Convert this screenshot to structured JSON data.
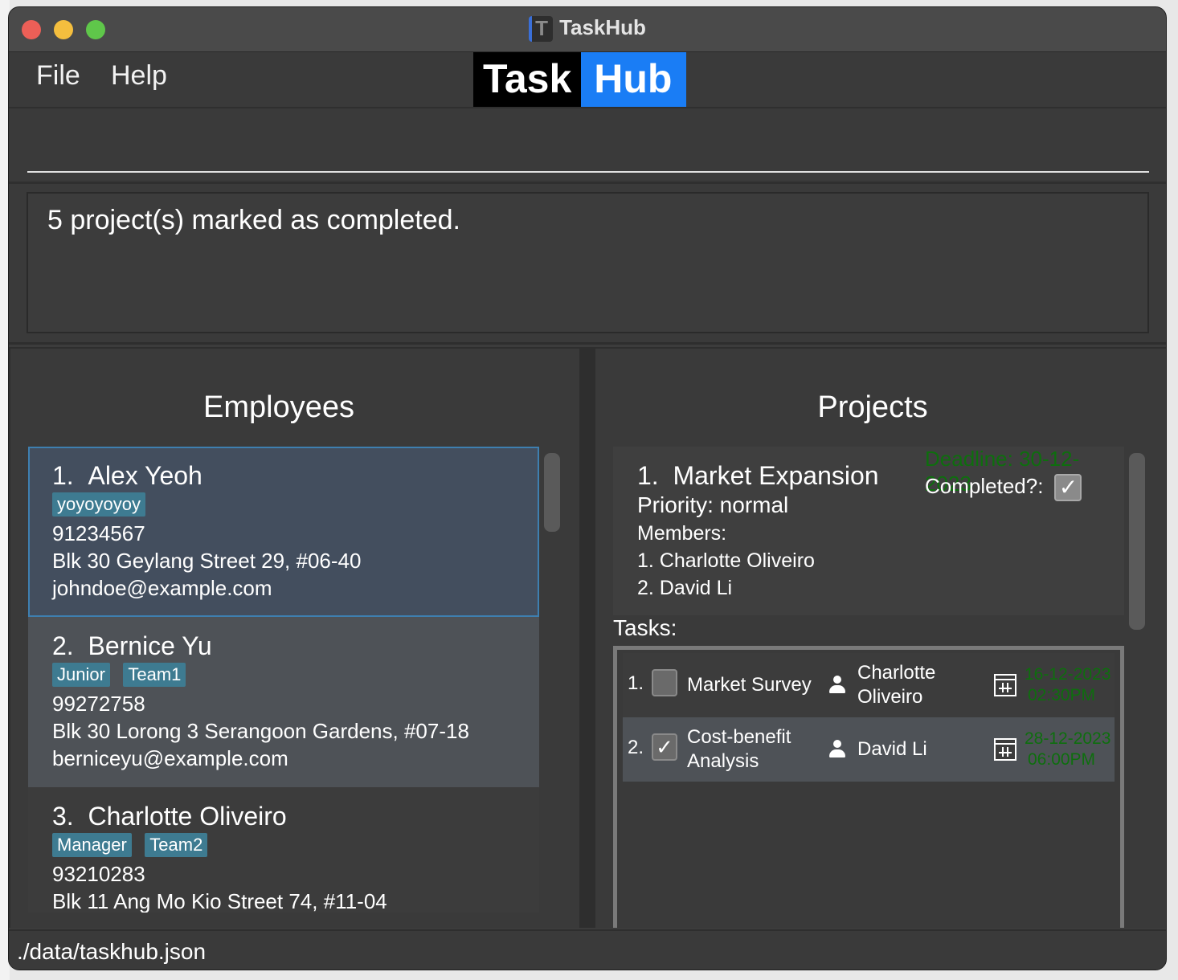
{
  "window": {
    "title": "TaskHub"
  },
  "menu": {
    "file": "File",
    "help": "Help"
  },
  "logo": {
    "part1": "Task",
    "part2": "Hub"
  },
  "result": {
    "text": "5 project(s) marked as completed."
  },
  "employees": {
    "title": "Employees",
    "items": [
      {
        "index": "1.",
        "name": "Alex Yeoh",
        "tags": [
          "yoyoyoyoy"
        ],
        "phone": "91234567",
        "address": "Blk 30 Geylang Street 29, #06-40",
        "email": "johndoe@example.com"
      },
      {
        "index": "2.",
        "name": "Bernice Yu",
        "tags": [
          "Junior",
          "Team1"
        ],
        "phone": "99272758",
        "address": "Blk 30 Lorong 3 Serangoon Gardens, #07-18",
        "email": "berniceyu@example.com"
      },
      {
        "index": "3.",
        "name": "Charlotte Oliveiro",
        "tags": [
          "Manager",
          "Team2"
        ],
        "phone": "93210283",
        "address": "Blk 11 Ang Mo Kio Street 74, #11-04"
      }
    ]
  },
  "projects": {
    "title": "Projects",
    "items": [
      {
        "index": "1.",
        "name": "Market Expansion",
        "priority": "Priority: normal",
        "members_label": "Members:",
        "members": [
          "1. Charlotte Oliveiro",
          "2. David Li"
        ],
        "deadline": "Deadline: 30-12-2023",
        "completed_label": "Completed?:",
        "completed": true,
        "tasks_label": "Tasks:",
        "tasks": [
          {
            "index": "1.",
            "done": false,
            "name_lines": [
              "Market Survey"
            ],
            "assignee_lines": [
              "Charlotte",
              "Oliveiro"
            ],
            "date": "16-12-2023",
            "time": "02:30PM"
          },
          {
            "index": "2.",
            "done": true,
            "name_lines": [
              "Cost-benefit",
              "Analysis"
            ],
            "assignee_lines": [
              "David Li"
            ],
            "date": "28-12-2023",
            "time": "06:00PM"
          }
        ]
      }
    ]
  },
  "status": {
    "path": "./data/taskhub.json"
  },
  "colors": {
    "accent": "#1a7df5",
    "tag": "#3e7b91",
    "deadline": "#0e6e0e",
    "selected_border": "#3e7fb0"
  }
}
